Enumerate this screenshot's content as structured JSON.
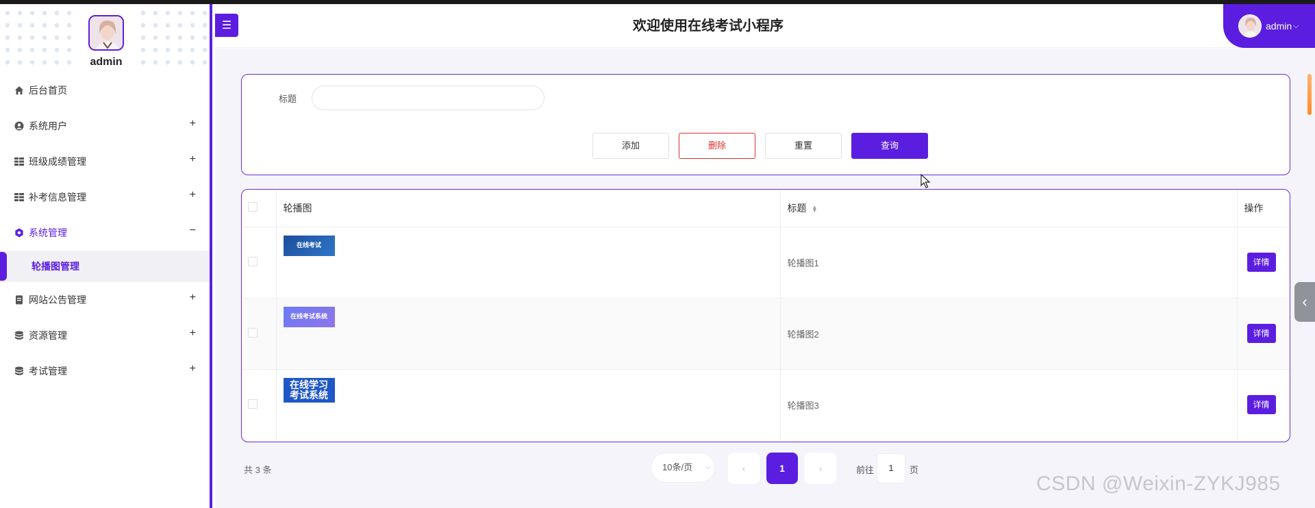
{
  "sidebar": {
    "username": "admin",
    "items": [
      {
        "label": "后台首页",
        "icon": "home-icon",
        "has_plus": false
      },
      {
        "label": "系统用户",
        "icon": "user-circle-icon",
        "has_plus": true
      },
      {
        "label": "班级成绩管理",
        "icon": "grid-icon",
        "has_plus": true
      },
      {
        "label": "补考信息管理",
        "icon": "grid-icon",
        "has_plus": true
      },
      {
        "label": "系统管理",
        "icon": "gear-icon",
        "has_plus": false,
        "expanded": true
      },
      {
        "label": "网站公告管理",
        "icon": "document-icon",
        "has_plus": true
      },
      {
        "label": "资源管理",
        "icon": "database-icon",
        "has_plus": true
      },
      {
        "label": "考试管理",
        "icon": "database-icon",
        "has_plus": true
      }
    ],
    "plus": "+",
    "minus": "−",
    "active_sub": "轮播图管理"
  },
  "header": {
    "menu_toggle": "☰",
    "title": "欢迎使用在线考试小程序",
    "user": "admin",
    "user_caret": "⌵"
  },
  "search": {
    "label": "标题",
    "value": "",
    "placeholder": "",
    "add": "添加",
    "delete": "删除",
    "reset": "重置",
    "query": "查询"
  },
  "table": {
    "headers": {
      "image": "轮播图",
      "title": "标题",
      "action": "操作"
    },
    "rows": [
      {
        "thumb_text": "在线考试",
        "title": "轮播图1",
        "action": "详情"
      },
      {
        "thumb_text": "在线考试系统",
        "title": "轮播图2",
        "action": "详情"
      },
      {
        "thumb_text": "在线学习\n考试系统",
        "title": "轮播图3",
        "action": "详情"
      }
    ]
  },
  "pagination": {
    "total": "共 3 条",
    "page_size": "10条/页",
    "prev": "‹",
    "current": "1",
    "next": "›",
    "goto_label": "前往",
    "goto_value": "1",
    "goto_suffix": "页"
  },
  "watermark": "CSDN @Weixin-ZYKJ985",
  "colors": {
    "accent": "#5b1ee0",
    "danger": "#d9302b",
    "scroll": "#ff8a2b"
  }
}
